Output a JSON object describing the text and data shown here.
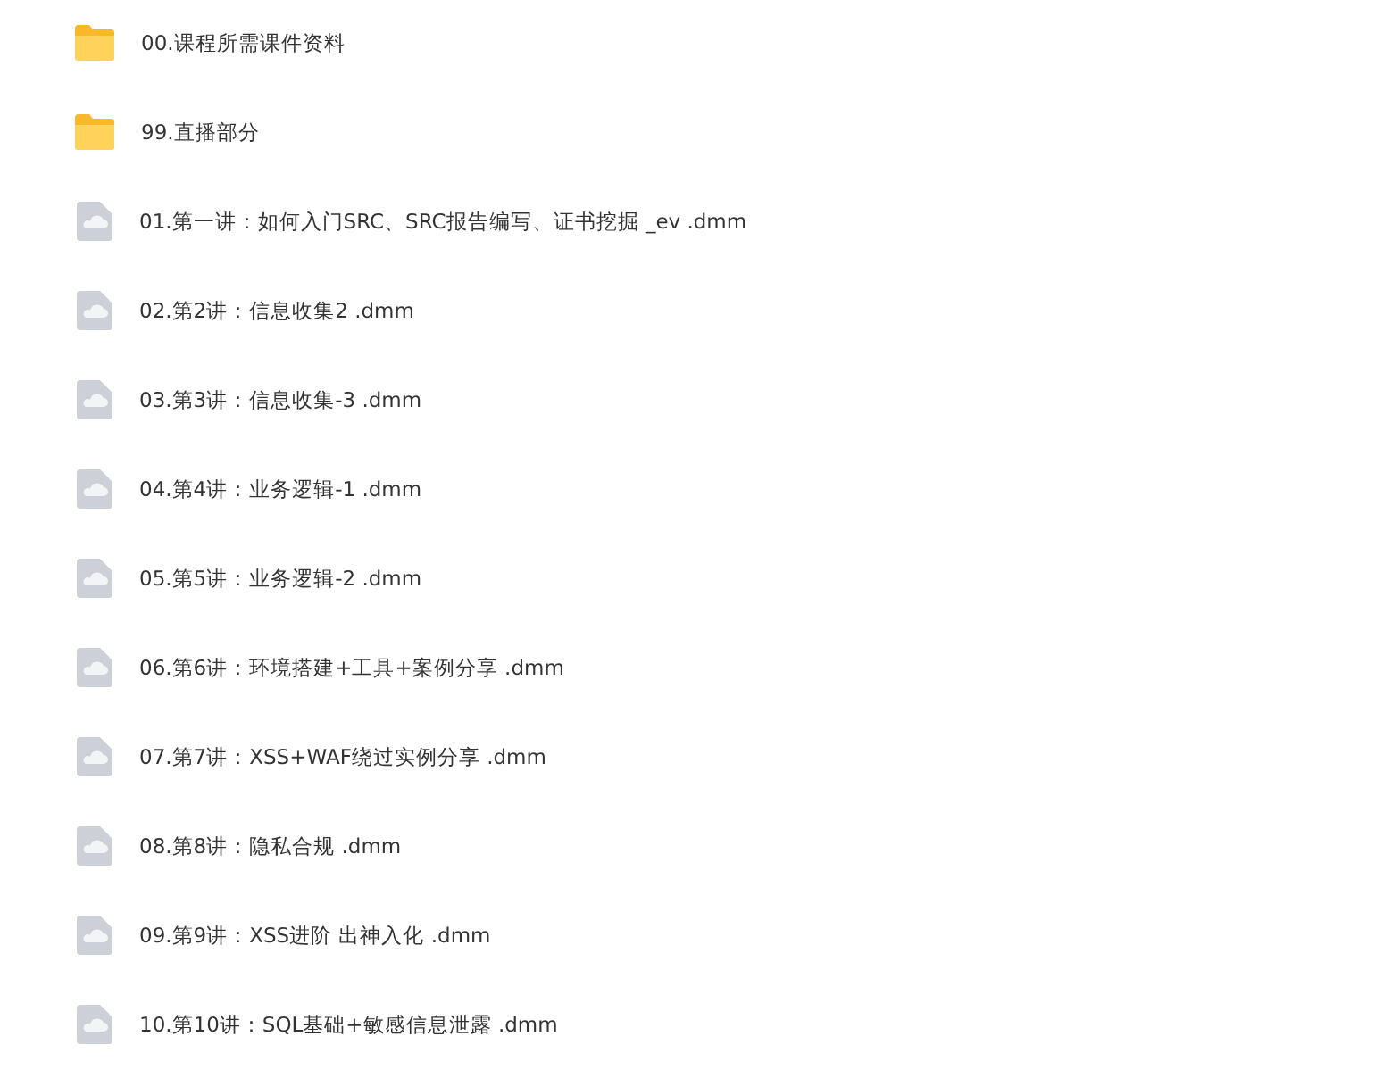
{
  "files": [
    {
      "kind": "folder",
      "name": "00.课程所需课件资料"
    },
    {
      "kind": "folder",
      "name": "99.直播部分"
    },
    {
      "kind": "file",
      "name": "01.第一讲：如何入门SRC、SRC报告编写、证书挖掘 _ev .dmm"
    },
    {
      "kind": "file",
      "name": "02.第2讲：信息收集2 .dmm"
    },
    {
      "kind": "file",
      "name": "03.第3讲：信息收集-3 .dmm"
    },
    {
      "kind": "file",
      "name": "04.第4讲：业务逻辑-1 .dmm"
    },
    {
      "kind": "file",
      "name": "05.第5讲：业务逻辑-2 .dmm"
    },
    {
      "kind": "file",
      "name": "06.第6讲：环境搭建+工具+案例分享 .dmm"
    },
    {
      "kind": "file",
      "name": "07.第7讲：XSS+WAF绕过实例分享 .dmm"
    },
    {
      "kind": "file",
      "name": "08.第8讲：隐私合规 .dmm"
    },
    {
      "kind": "file",
      "name": "09.第9讲：XSS进阶 出神入化 .dmm"
    },
    {
      "kind": "file",
      "name": "10.第10讲：SQL基础+敏感信息泄露 .dmm"
    }
  ]
}
